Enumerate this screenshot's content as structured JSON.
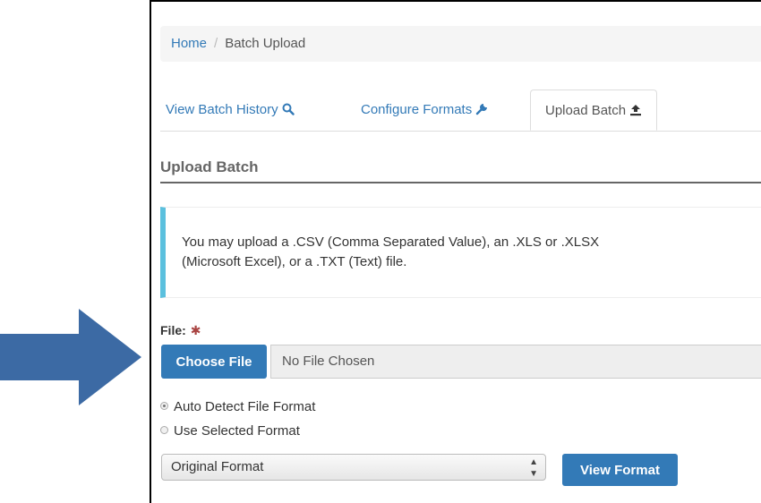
{
  "breadcrumb": {
    "home": "Home",
    "separator": "/",
    "current": "Batch Upload"
  },
  "tabs": [
    {
      "label": "View Batch History",
      "icon": "search-icon"
    },
    {
      "label": "Configure Formats",
      "icon": "wrench-icon"
    },
    {
      "label": "Upload Batch",
      "icon": "upload-icon",
      "active": true
    }
  ],
  "section": {
    "title": "Upload Batch"
  },
  "info": {
    "line1": "You may upload a .CSV (Comma Separated Value), an .XLS or .XLSX",
    "line2": "(Microsoft Excel), or a .TXT (Text) file."
  },
  "file": {
    "label": "File:",
    "required_mark": "✱",
    "choose_label": "Choose File",
    "value": "No File Chosen"
  },
  "format_mode": {
    "options": [
      {
        "label": "Auto Detect File Format",
        "checked": true
      },
      {
        "label": "Use Selected Format",
        "checked": false
      }
    ]
  },
  "format_select": {
    "value": "Original Format",
    "caret": "⬍"
  },
  "view_format_label": "View Format",
  "colors": {
    "primary": "#337ab7",
    "info_border": "#5bc0de",
    "arrow": "#3c6aa4"
  }
}
